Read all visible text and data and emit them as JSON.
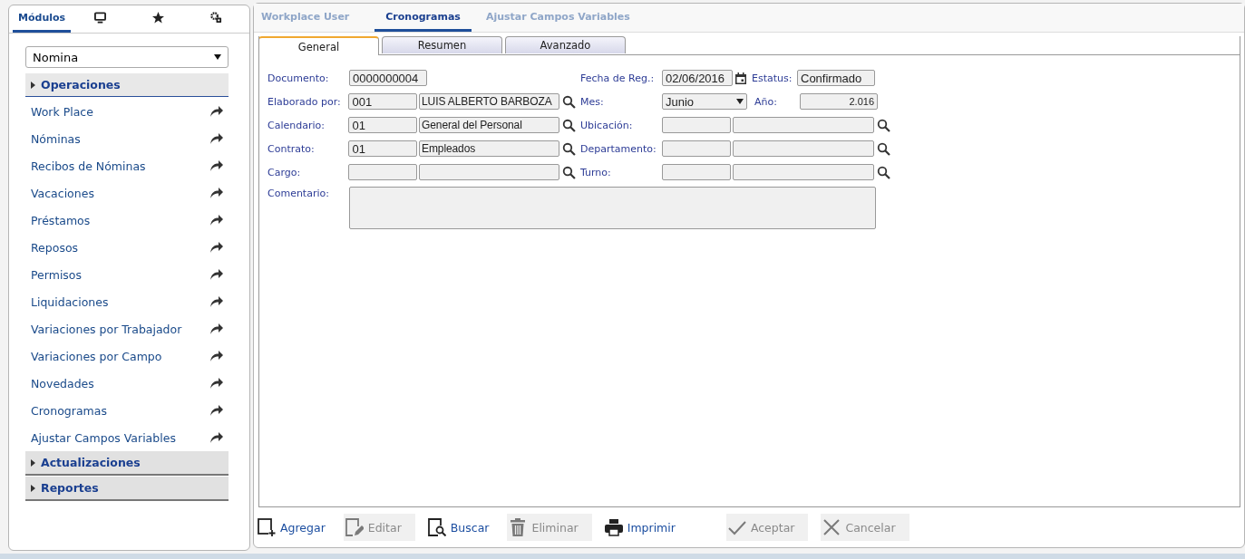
{
  "sidebar": {
    "tabs": [
      {
        "label": "Módulos",
        "selected": true
      },
      {
        "selected": false
      },
      {
        "selected": false
      },
      {
        "selected": false
      }
    ],
    "module_select": {
      "value": "Nomina"
    },
    "sections": [
      {
        "label": "Operaciones",
        "expanded": true,
        "items": [
          "Work Place",
          "Nóminas",
          "Recibos de Nóminas",
          "Vacaciones",
          "Préstamos",
          "Reposos",
          "Permisos",
          "Liquidaciones",
          "Variaciones por Trabajador",
          "Variaciones por Campo",
          "Novedades",
          "Cronogramas",
          "Ajustar Campos Variables"
        ]
      },
      {
        "label": "Actualizaciones",
        "expanded": false
      },
      {
        "label": "Reportes",
        "expanded": false
      }
    ]
  },
  "tabs": [
    {
      "label": "Workplace User",
      "selected": false
    },
    {
      "label": "Cronogramas",
      "selected": true
    },
    {
      "label": "Ajustar Campos Variables",
      "selected": false
    }
  ],
  "subtabs": [
    {
      "label": "General",
      "selected": true
    },
    {
      "label": "Resumen",
      "selected": false
    },
    {
      "label": "Avanzado",
      "selected": false
    }
  ],
  "form": {
    "rows": [
      {
        "left": {
          "kind": "single",
          "label": "Documento:",
          "value": "0000000004"
        },
        "right": {
          "kind": "date_status",
          "label": "Fecha de Reg.:",
          "value": "02/06/2016",
          "status_label": "Estatus:",
          "status": "Confirmado"
        }
      },
      {
        "left": {
          "kind": "lookup",
          "label": "Elaborado por:",
          "code": "001",
          "name": "LUIS ALBERTO BARBOZA"
        },
        "right": {
          "kind": "month_year",
          "label": "Mes:",
          "value": "Junio",
          "year_label": "Año:",
          "year": "2.016"
        }
      },
      {
        "left": {
          "kind": "lookup",
          "label": "Calendario:",
          "code": "01",
          "name": "General del Personal"
        },
        "right": {
          "kind": "lookup",
          "label": "Ubicación:"
        }
      },
      {
        "left": {
          "kind": "lookup",
          "label": "Contrato:",
          "code": "01",
          "name": "Empleados"
        },
        "right": {
          "kind": "lookup",
          "label": "Departamento:"
        }
      },
      {
        "left": {
          "kind": "lookup",
          "label": "Cargo:"
        },
        "right": {
          "kind": "lookup",
          "label": "Turno:"
        }
      }
    ],
    "comment": {
      "label": "Comentario:"
    }
  },
  "toolbar": [
    {
      "kind": "add",
      "label": "Agregar",
      "disabled": false
    },
    {
      "kind": "edit",
      "label": "Editar",
      "disabled": true
    },
    {
      "kind": "search",
      "label": "Buscar",
      "disabled": false
    },
    {
      "kind": "delete",
      "label": "Eliminar",
      "disabled": true
    },
    {
      "kind": "print",
      "label": "Imprimir",
      "disabled": false
    },
    {
      "kind": "accept",
      "label": "Aceptar",
      "disabled": true
    },
    {
      "kind": "cancel",
      "label": "Cancelar",
      "disabled": true
    }
  ]
}
